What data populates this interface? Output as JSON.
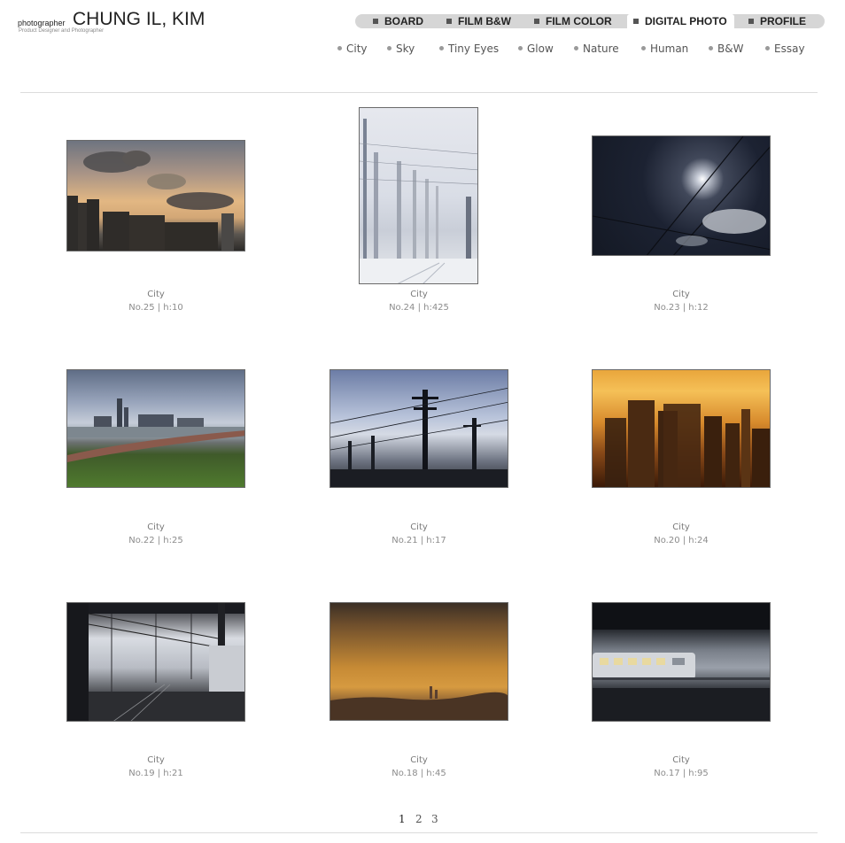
{
  "header": {
    "label_small": "photographer",
    "name": "CHUNG IL, KIM",
    "tagline": "Product Designer and Photographer"
  },
  "main_nav": [
    {
      "label": "BOARD",
      "active": false
    },
    {
      "label": "FILM B&W",
      "active": false
    },
    {
      "label": "FILM COLOR",
      "active": false
    },
    {
      "label": "DIGITAL PHOTO",
      "active": true
    },
    {
      "label": "PROFILE",
      "active": false
    }
  ],
  "sub_nav": [
    "City",
    "Sky",
    "Tiny Eyes",
    "Glow",
    "Nature",
    "Human",
    "B&W",
    "Essay"
  ],
  "gallery": [
    {
      "category": "City",
      "meta": "No.25 | h:10"
    },
    {
      "category": "City",
      "meta": "No.24 | h:425"
    },
    {
      "category": "City",
      "meta": "No.23 | h:12"
    },
    {
      "category": "City",
      "meta": "No.22 | h:25"
    },
    {
      "category": "City",
      "meta": "No.21 | h:17"
    },
    {
      "category": "City",
      "meta": "No.20 | h:24"
    },
    {
      "category": "City",
      "meta": "No.19 | h:21"
    },
    {
      "category": "City",
      "meta": "No.18 | h:45"
    },
    {
      "category": "City",
      "meta": "No.17 | h:95"
    }
  ],
  "pagination": {
    "pages": [
      "1",
      "2",
      "3"
    ],
    "current": "1"
  },
  "colors": {
    "nav_bg": "#d6d6d6",
    "nav_active_bg": "#ffffff",
    "caption": "#8c8c8c"
  }
}
